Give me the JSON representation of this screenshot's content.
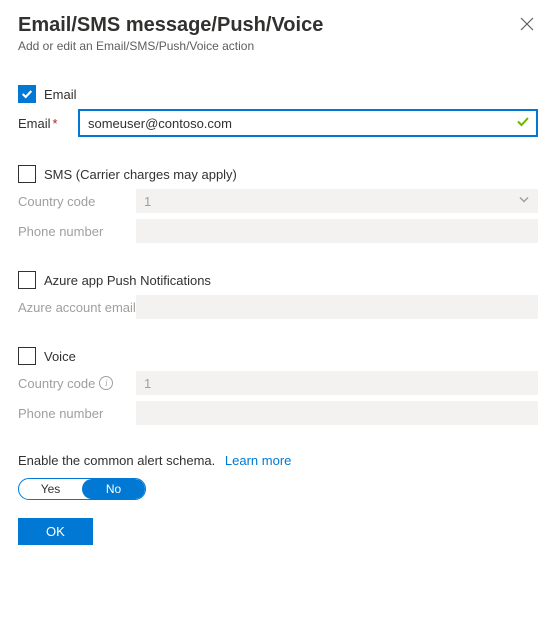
{
  "header": {
    "title": "Email/SMS message/Push/Voice",
    "subtitle": "Add or edit an Email/SMS/Push/Voice action"
  },
  "email": {
    "checkbox_label": "Email",
    "checked": true,
    "field_label": "Email",
    "value": "someuser@contoso.com"
  },
  "sms": {
    "checkbox_label": "SMS (Carrier charges may apply)",
    "country_code_label": "Country code",
    "country_code_value": "1",
    "phone_label": "Phone number"
  },
  "push": {
    "checkbox_label": "Azure app Push Notifications",
    "account_label": "Azure account email"
  },
  "voice": {
    "checkbox_label": "Voice",
    "country_code_label": "Country code",
    "country_code_value": "1",
    "phone_label": "Phone number"
  },
  "schema": {
    "text": "Enable the common alert schema.",
    "link": "Learn more",
    "yes": "Yes",
    "no": "No"
  },
  "buttons": {
    "ok": "OK"
  }
}
